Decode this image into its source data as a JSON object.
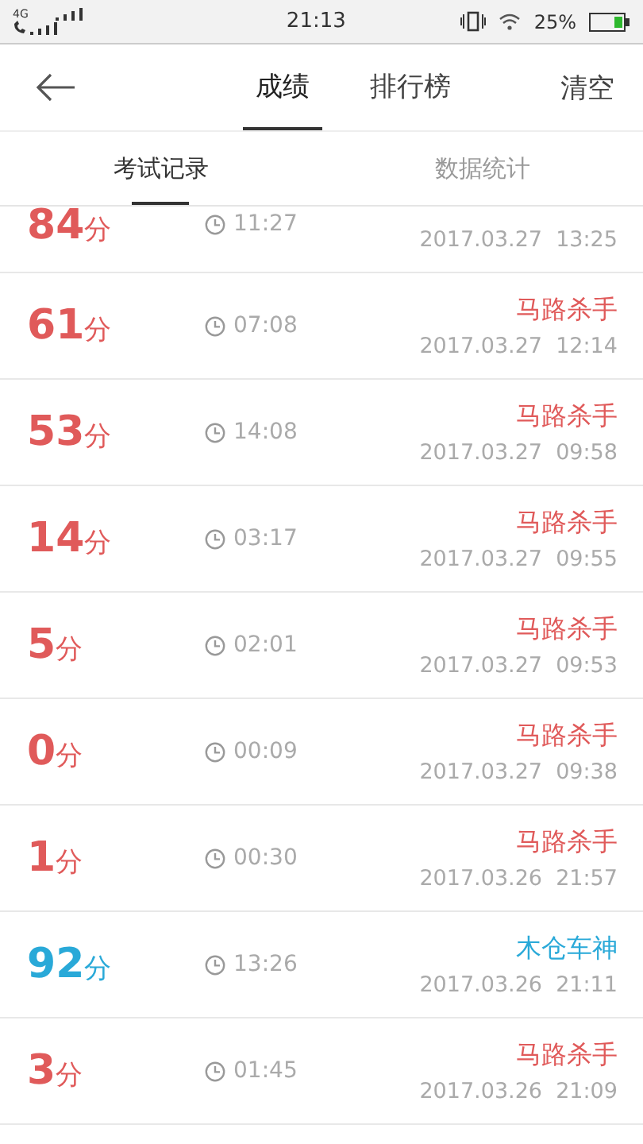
{
  "status_bar": {
    "network": "4G",
    "time": "21:13",
    "battery": "25%"
  },
  "header": {
    "tabs": [
      {
        "label": "成绩",
        "selected": true
      },
      {
        "label": "排行榜",
        "selected": false
      }
    ],
    "action": "清空"
  },
  "subtabs": [
    {
      "label": "考试记录",
      "selected": true
    },
    {
      "label": "数据统计",
      "selected": false
    }
  ],
  "records": [
    {
      "score": "84",
      "unit": "分",
      "duration": "11:27",
      "date": "2017.03.27  13:25",
      "color": "#e05a5a"
    },
    {
      "score": "61",
      "unit": "分",
      "duration": "07:08",
      "title": "马路杀手",
      "date": "2017.03.27  12:14",
      "color": "#e05a5a"
    },
    {
      "score": "53",
      "unit": "分",
      "duration": "14:08",
      "title": "马路杀手",
      "date": "2017.03.27  09:58",
      "color": "#e05a5a"
    },
    {
      "score": "14",
      "unit": "分",
      "duration": "03:17",
      "title": "马路杀手",
      "date": "2017.03.27  09:55",
      "color": "#e05a5a"
    },
    {
      "score": "5",
      "unit": "分",
      "duration": "02:01",
      "title": "马路杀手",
      "date": "2017.03.27  09:53",
      "color": "#e05a5a"
    },
    {
      "score": "0",
      "unit": "分",
      "duration": "00:09",
      "title": "马路杀手",
      "date": "2017.03.27  09:38",
      "color": "#e05a5a"
    },
    {
      "score": "1",
      "unit": "分",
      "duration": "00:30",
      "title": "马路杀手",
      "date": "2017.03.26  21:57",
      "color": "#e05a5a"
    },
    {
      "score": "92",
      "unit": "分",
      "duration": "13:26",
      "title": "木仓车神",
      "date": "2017.03.26  21:11",
      "color": "#29a9d8"
    },
    {
      "score": "3",
      "unit": "分",
      "duration": "01:45",
      "title": "马路杀手",
      "date": "2017.03.26  21:09",
      "color": "#e05a5a"
    }
  ]
}
